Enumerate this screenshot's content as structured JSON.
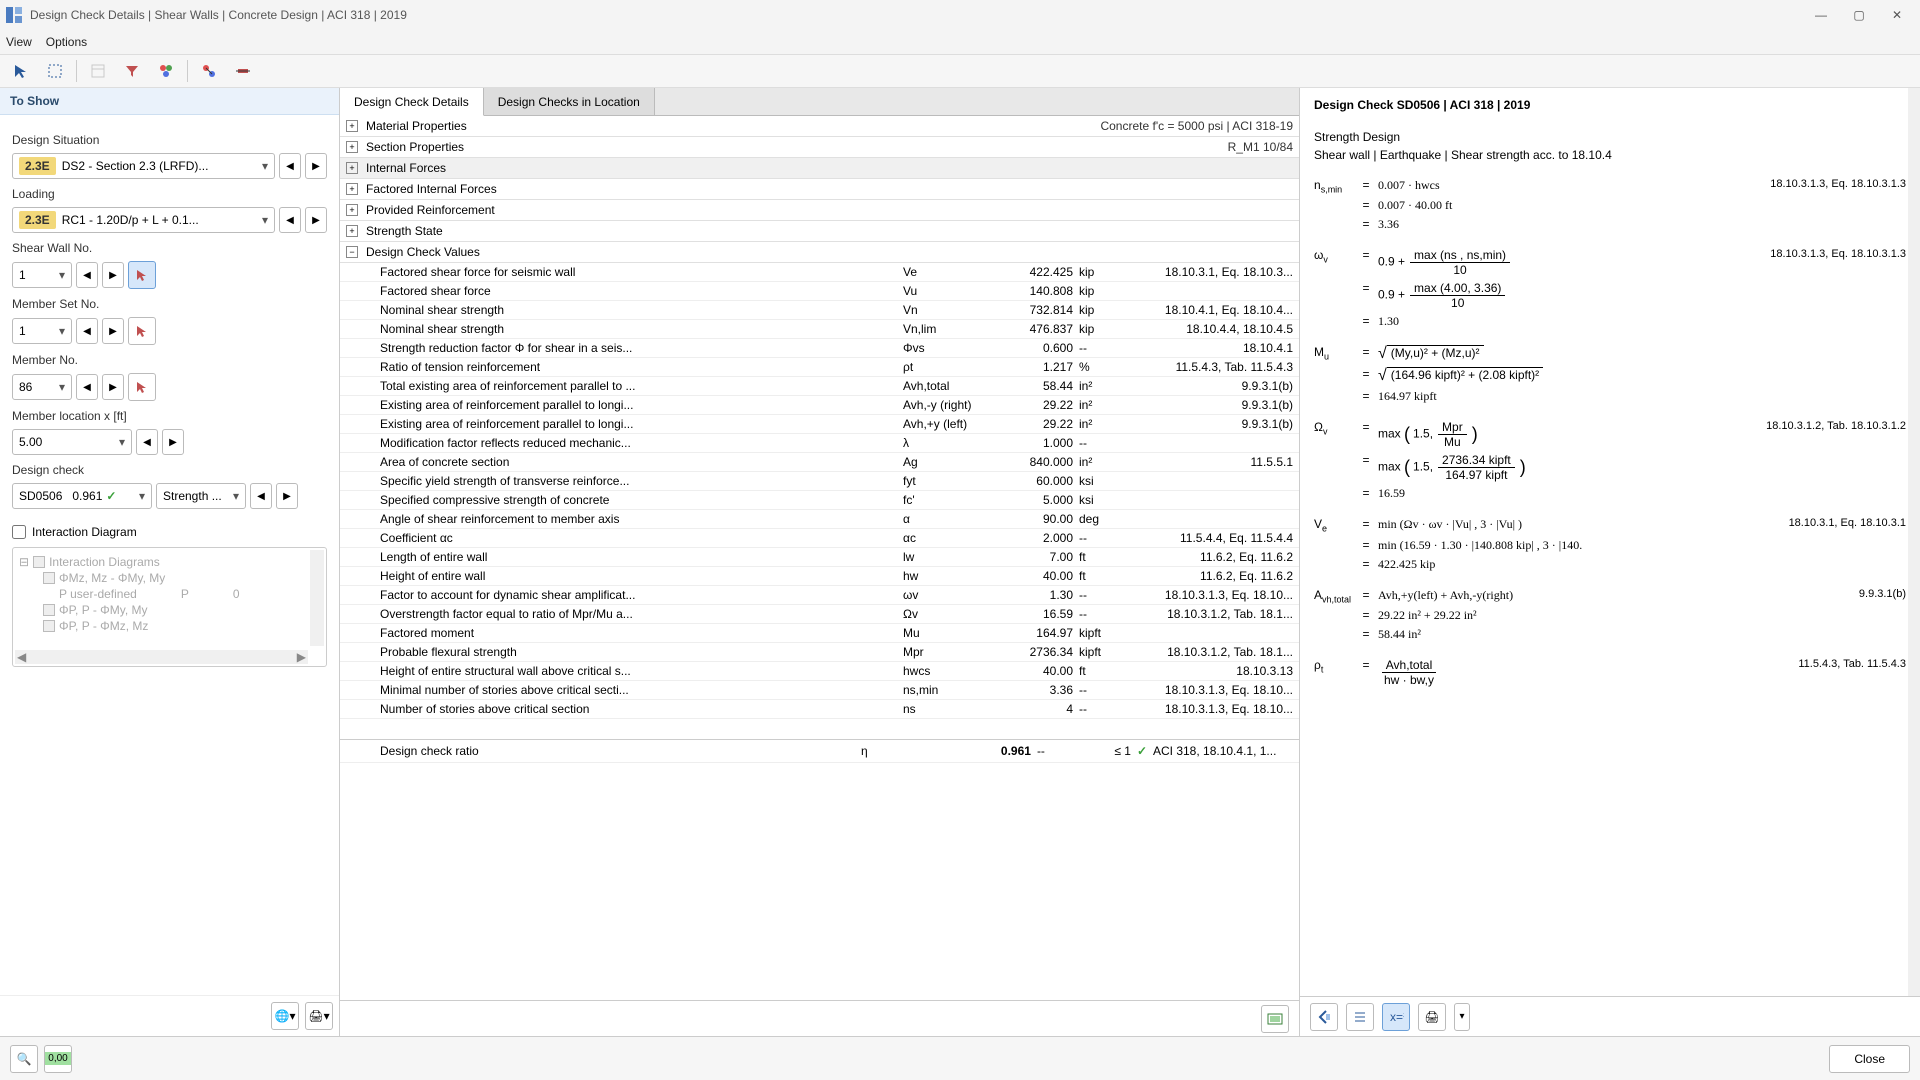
{
  "titlebar": {
    "title": "Design Check Details | Shear Walls | Concrete Design | ACI 318 | 2019"
  },
  "menubar": {
    "view": "View",
    "options": "Options"
  },
  "leftpanel": {
    "header": "To Show",
    "design_situation": {
      "label": "Design Situation",
      "badge": "2.3E",
      "value": "DS2 - Section 2.3 (LRFD)..."
    },
    "loading": {
      "label": "Loading",
      "badge": "2.3E",
      "value": "RC1 - 1.20D/p + L + 0.1..."
    },
    "shear_wall": {
      "label": "Shear Wall No.",
      "value": "1"
    },
    "member_set": {
      "label": "Member Set No.",
      "value": "1"
    },
    "member_no": {
      "label": "Member No.",
      "value": "86"
    },
    "location": {
      "label": "Member location x [ft]",
      "value": "5.00"
    },
    "design_check": {
      "label": "Design check",
      "code": "SD0506",
      "ratio": "0.961",
      "type": "Strength ..."
    },
    "interaction": {
      "label": "Interaction Diagram",
      "root": "Interaction Diagrams",
      "row1": "ΦMz, Mz - ΦMy, My",
      "row2_label": "P user-defined",
      "row2_p": "P",
      "row2_val": "0",
      "row3": "ΦP, P - ΦMy, My",
      "row4": "ΦP, P - ΦMz, Mz"
    }
  },
  "tabs": {
    "details": "Design Check Details",
    "location": "Design Checks in Location"
  },
  "sections": {
    "material": {
      "label": "Material Properties",
      "right": "Concrete f'c = 5000 psi | ACI 318-19"
    },
    "section": {
      "label": "Section Properties",
      "right": "R_M1 10/84"
    },
    "internal": {
      "label": "Internal Forces"
    },
    "factored": {
      "label": "Factored Internal Forces"
    },
    "provided": {
      "label": "Provided Reinforcement"
    },
    "strength": {
      "label": "Strength State"
    },
    "values": {
      "label": "Design Check Values"
    }
  },
  "rows": [
    {
      "label": "Factored shear force for seismic wall",
      "sym": "Ve",
      "val": "422.425",
      "unit": "kip",
      "ref": "18.10.3.1, Eq. 18.10.3..."
    },
    {
      "label": "Factored shear force",
      "sym": "Vu",
      "val": "140.808",
      "unit": "kip",
      "ref": ""
    },
    {
      "label": "Nominal shear strength",
      "sym": "Vn",
      "val": "732.814",
      "unit": "kip",
      "ref": "18.10.4.1, Eq. 18.10.4..."
    },
    {
      "label": "Nominal shear strength",
      "sym": "Vn,lim",
      "val": "476.837",
      "unit": "kip",
      "ref": "18.10.4.4, 18.10.4.5"
    },
    {
      "label": "Strength reduction factor Φ for shear in a seis...",
      "sym": "Φvs",
      "val": "0.600",
      "unit": "--",
      "ref": "18.10.4.1"
    },
    {
      "label": "Ratio of tension reinforcement",
      "sym": "ρt",
      "val": "1.217",
      "unit": "%",
      "ref": "11.5.4.3, Tab. 11.5.4.3"
    },
    {
      "label": "Total existing area of reinforcement parallel to ...",
      "sym": "Avh,total",
      "val": "58.44",
      "unit": "in²",
      "ref": "9.9.3.1(b)"
    },
    {
      "label": "Existing area of reinforcement parallel to longi...",
      "sym": "Avh,-y (right)",
      "val": "29.22",
      "unit": "in²",
      "ref": "9.9.3.1(b)"
    },
    {
      "label": "Existing area of reinforcement parallel to longi...",
      "sym": "Avh,+y (left)",
      "val": "29.22",
      "unit": "in²",
      "ref": "9.9.3.1(b)"
    },
    {
      "label": "Modification factor reflects reduced mechanic...",
      "sym": "λ",
      "val": "1.000",
      "unit": "--",
      "ref": ""
    },
    {
      "label": "Area of concrete section",
      "sym": "Ag",
      "val": "840.000",
      "unit": "in²",
      "ref": "11.5.5.1"
    },
    {
      "label": "Specific yield strength of transverse reinforce...",
      "sym": "fyt",
      "val": "60.000",
      "unit": "ksi",
      "ref": ""
    },
    {
      "label": "Specified compressive strength of concrete",
      "sym": "fc'",
      "val": "5.000",
      "unit": "ksi",
      "ref": ""
    },
    {
      "label": "Angle of shear reinforcement to member axis",
      "sym": "α",
      "val": "90.00",
      "unit": "deg",
      "ref": ""
    },
    {
      "label": "Coefficient αc",
      "sym": "αc",
      "val": "2.000",
      "unit": "--",
      "ref": "11.5.4.4, Eq. 11.5.4.4"
    },
    {
      "label": "Length of entire wall",
      "sym": "lw",
      "val": "7.00",
      "unit": "ft",
      "ref": "11.6.2, Eq. 11.6.2"
    },
    {
      "label": "Height of entire wall",
      "sym": "hw",
      "val": "40.00",
      "unit": "ft",
      "ref": "11.6.2, Eq. 11.6.2"
    },
    {
      "label": "Factor to account for dynamic shear amplificat...",
      "sym": "ωv",
      "val": "1.30",
      "unit": "--",
      "ref": "18.10.3.1.3, Eq. 18.10..."
    },
    {
      "label": "Overstrength factor equal to ratio of Mpr/Mu a...",
      "sym": "Ωv",
      "val": "16.59",
      "unit": "--",
      "ref": "18.10.3.1.2, Tab. 18.1..."
    },
    {
      "label": "Factored moment",
      "sym": "Mu",
      "val": "164.97",
      "unit": "kipft",
      "ref": ""
    },
    {
      "label": "Probable flexural strength",
      "sym": "Mpr",
      "val": "2736.34",
      "unit": "kipft",
      "ref": "18.10.3.1.2, Tab. 18.1..."
    },
    {
      "label": "Height of entire structural wall above critical s...",
      "sym": "hwcs",
      "val": "40.00",
      "unit": "ft",
      "ref": "18.10.3.13"
    },
    {
      "label": "Minimal number of stories above critical secti...",
      "sym": "ns,min",
      "val": "3.36",
      "unit": "--",
      "ref": "18.10.3.1.3, Eq. 18.10..."
    },
    {
      "label": "Number of stories above critical section",
      "sym": "ns",
      "val": "4",
      "unit": "--",
      "ref": "18.10.3.1.3, Eq. 18.10..."
    }
  ],
  "ratio_row": {
    "label": "Design check ratio",
    "sym": "η",
    "val": "0.961",
    "unit": "--",
    "limit": "≤ 1",
    "ref": "ACI 318, 18.10.4.1, 1..."
  },
  "rightpanel": {
    "title": "Design Check SD0506 | ACI 318 | 2019",
    "sub1": "Strength Design",
    "sub2": "Shear wall | Earthquake | Shear strength acc. to 18.10.4",
    "eq": {
      "nsmin_sym": "ns,min",
      "nsmin_1": "0.007  ·  hwcs",
      "nsmin_ref": "18.10.3.1.3, Eq. 18.10.3.1.3",
      "nsmin_2": "0.007  ·  40.00 ft",
      "nsmin_3": "3.36",
      "wv_sym": "ωv",
      "wv_num1": "max (ns ,  ns,min)",
      "wv_den": "10",
      "wv_plus": "0.9  +",
      "wv_ref": "18.10.3.1.3, Eq. 18.10.3.1.3",
      "wv_num2": "max (4.00,  3.36)",
      "wv_3": "1.30",
      "mu_sym": "Mu",
      "mu_rad1": "(My,u)²   +   (Mz,u)²",
      "mu_rad2": "(164.96 kipft)²   +   (2.08 kipft)²",
      "mu_3": "164.97 kipft",
      "ov_sym": "Ωv",
      "ov_num1": "Mpr",
      "ov_den1": "Mu",
      "ov_pre": "max ",
      "ov_lp": "(",
      "ov_rp": ")",
      "ov_15": "1.5,",
      "ov_ref": "18.10.3.1.2, Tab. 18.10.3.1.2",
      "ov_num2": "2736.34 kipft",
      "ov_den2": "164.97 kipft",
      "ov_3": "16.59",
      "ve_sym": "Ve",
      "ve_1": "min (Ωv  ·  ωv  ·  |Vu| ,  3  ·  |Vu| )",
      "ve_ref": "18.10.3.1, Eq. 18.10.3.1",
      "ve_2": "min (16.59  ·  1.30  ·  |140.808 kip| ,  3  ·  |140.",
      "ve_3": "422.425 kip",
      "avh_sym": "Avh,total",
      "avh_1": "Avh,+y(left)   +   Avh,-y(right)",
      "avh_ref": "9.9.3.1(b)",
      "avh_2": "29.22 in²   +   29.22 in²",
      "avh_3": "58.44 in²",
      "pt_sym": "ρt",
      "pt_num": "Avh,total",
      "pt_den": "hw  ·  bw,y",
      "pt_ref": "11.5.4.3, Tab. 11.5.4.3"
    }
  },
  "close": "Close"
}
